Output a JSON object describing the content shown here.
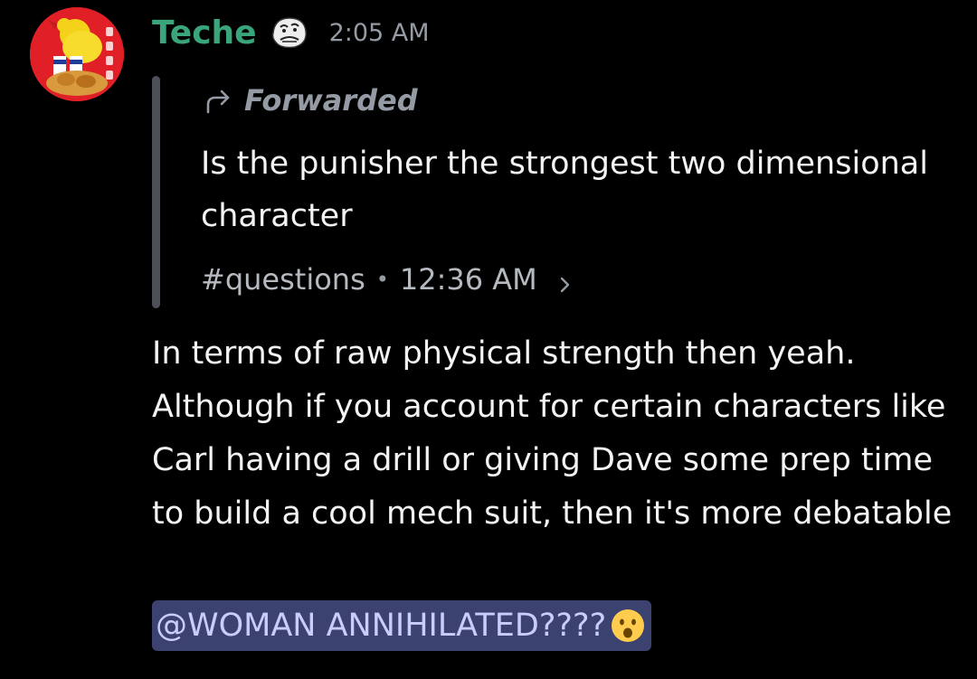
{
  "message": {
    "username": "Teche",
    "timestamp": "2:05 AM",
    "avatar_icon": "kfc-chicken-avatar",
    "role_icon": "meme-face-icon",
    "username_color": "#3aa57a"
  },
  "forwarded": {
    "label": "Forwarded",
    "text": "Is the punisher the strongest two dimensional character",
    "channel": "#questions",
    "separator": "•",
    "time": "12:36 AM"
  },
  "body": {
    "text": "In terms of raw physical strength then yeah. Although if you account for certain characters like Carl having a drill or giving Dave some prep time to build a cool mech suit, then it's more debatable"
  },
  "mention": {
    "text": "@WOMAN ANNIHILATED????",
    "emoji": "frowning-open-mouth-emoji",
    "color": "#c9cdfb",
    "background": "#3c4270"
  }
}
